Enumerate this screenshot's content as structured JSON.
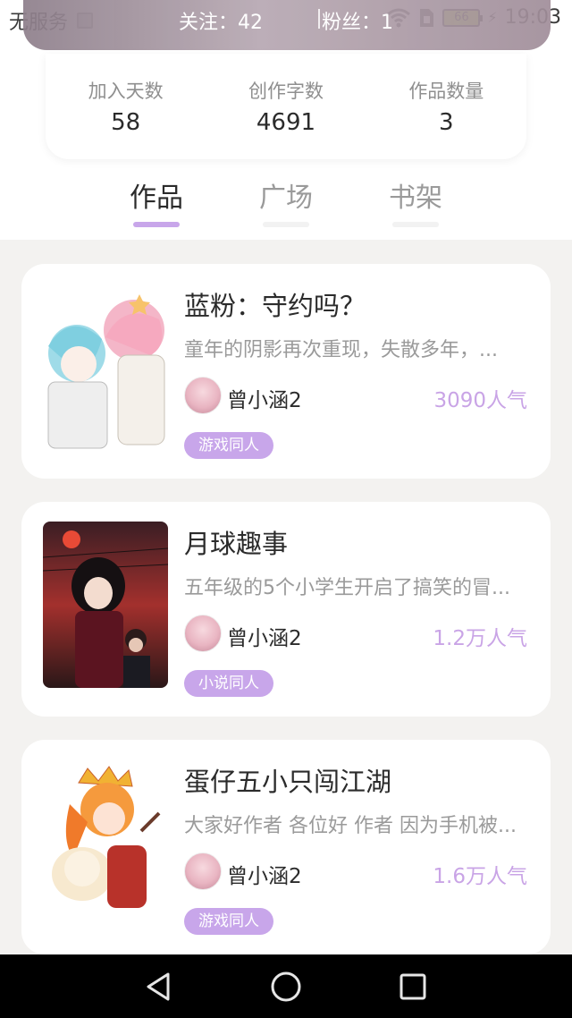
{
  "status_bar": {
    "carrier": "无服务",
    "battery": "66",
    "time": "19:03"
  },
  "profile_banner": {
    "follow": "关注：42",
    "fans": "粉丝：1"
  },
  "stats": [
    {
      "label": "加入天数",
      "value": "58"
    },
    {
      "label": "创作字数",
      "value": "4691"
    },
    {
      "label": "作品数量",
      "value": "3"
    }
  ],
  "tabs": [
    {
      "label": "作品",
      "active": true
    },
    {
      "label": "广场",
      "active": false
    },
    {
      "label": "书架",
      "active": false
    }
  ],
  "colors": {
    "accent": "#c8a6ea",
    "popularity": "#c9a4e6",
    "background": "#f3f2f0"
  },
  "works": [
    {
      "title": "蓝粉：守约吗？",
      "desc": "童年的阴影再次重现，失散多年，...",
      "author": "曾小涵2",
      "popularity": "3090人气",
      "tag": "游戏同人"
    },
    {
      "title": "月球趣事",
      "desc": "五年级的5个小学生开启了搞笑的冒...",
      "author": "曾小涵2",
      "popularity": "1.2万人气",
      "tag": "小说同人"
    },
    {
      "title": "蛋仔五小只闯江湖",
      "desc": "大家好作者 各位好 作者 因为手机被...",
      "author": "曾小涵2",
      "popularity": "1.6万人气",
      "tag": "游戏同人"
    }
  ],
  "nav": {
    "back": "back-icon",
    "home": "home-icon",
    "recents": "recents-icon"
  }
}
